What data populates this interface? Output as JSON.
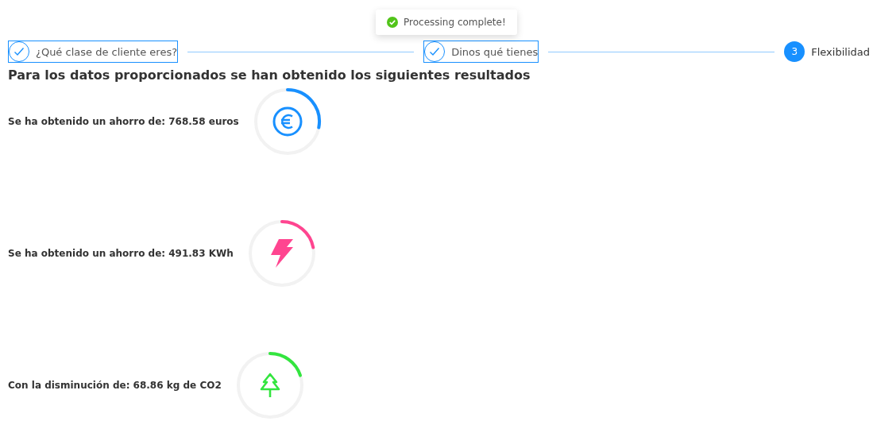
{
  "toast": {
    "kind": "success",
    "message": "Processing complete!"
  },
  "steps": [
    {
      "label": "¿Qué clase de cliente eres?",
      "completed": true
    },
    {
      "label": "Dinos qué tienes",
      "completed": true
    },
    {
      "label": "Flexibilidad",
      "completed": false,
      "number": "3"
    }
  ],
  "heading": "Para los datos proporcionados se han obtenido los siguientes resultados",
  "results": [
    {
      "text": "Se ha obtenido un ahorro de: 768.58 euros",
      "kind": "euro",
      "color": "#1890ff"
    },
    {
      "text": "Se ha obtenido un ahorro de: 491.83 KWh",
      "kind": "bolt",
      "color": "#ff4590"
    },
    {
      "text": "Con la disminución de: 68.86 kg de CO2",
      "kind": "tree",
      "color": "#33e53f"
    }
  ]
}
